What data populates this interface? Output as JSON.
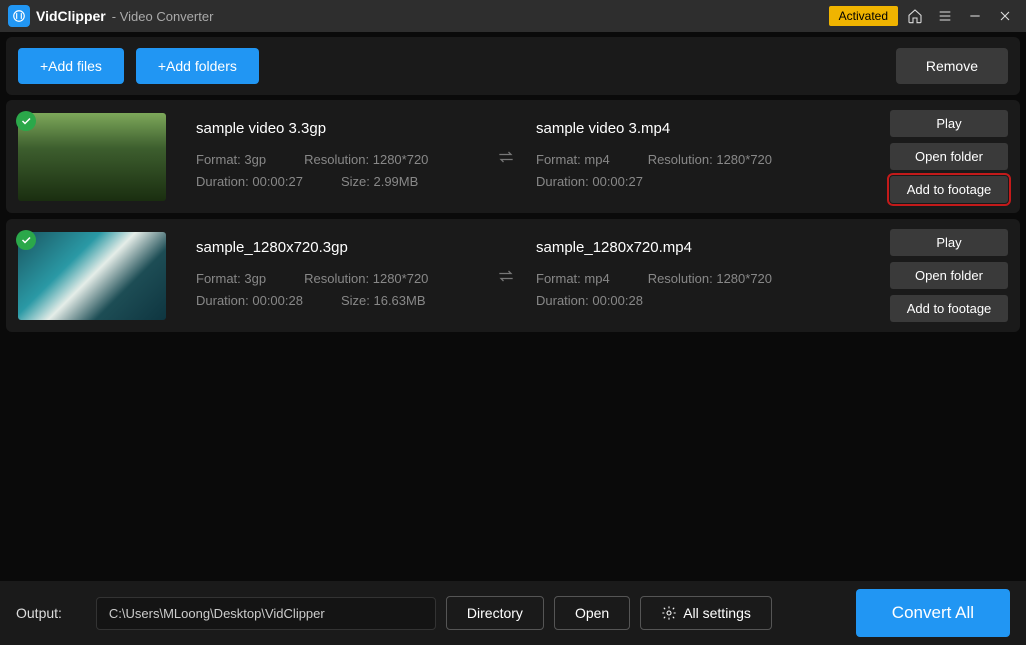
{
  "titlebar": {
    "app_name": "VidClipper",
    "subtitle": "- Video Converter",
    "activated_label": "Activated"
  },
  "toolbar": {
    "add_files": "+Add files",
    "add_folders": "+Add folders",
    "remove": "Remove"
  },
  "rows": [
    {
      "src": {
        "name": "sample video 3.3gp",
        "format": "Format: 3gp",
        "resolution": "Resolution: 1280*720",
        "duration": "Duration: 00:00:27",
        "size": "Size: 2.99MB"
      },
      "dst": {
        "name": "sample video 3.mp4",
        "format": "Format: mp4",
        "resolution": "Resolution: 1280*720",
        "duration": "Duration: 00:00:27"
      },
      "actions": {
        "play": "Play",
        "open": "Open folder",
        "add": "Add to footage"
      }
    },
    {
      "src": {
        "name": "sample_1280x720.3gp",
        "format": "Format: 3gp",
        "resolution": "Resolution: 1280*720",
        "duration": "Duration: 00:00:28",
        "size": "Size: 16.63MB"
      },
      "dst": {
        "name": "sample_1280x720.mp4",
        "format": "Format: mp4",
        "resolution": "Resolution: 1280*720",
        "duration": "Duration: 00:00:28"
      },
      "actions": {
        "play": "Play",
        "open": "Open folder",
        "add": "Add to footage"
      }
    }
  ],
  "footer": {
    "output_label": "Output:",
    "output_path": "C:\\Users\\MLoong\\Desktop\\VidClipper",
    "directory": "Directory",
    "open": "Open",
    "all_settings": "All settings",
    "convert": "Convert All"
  }
}
